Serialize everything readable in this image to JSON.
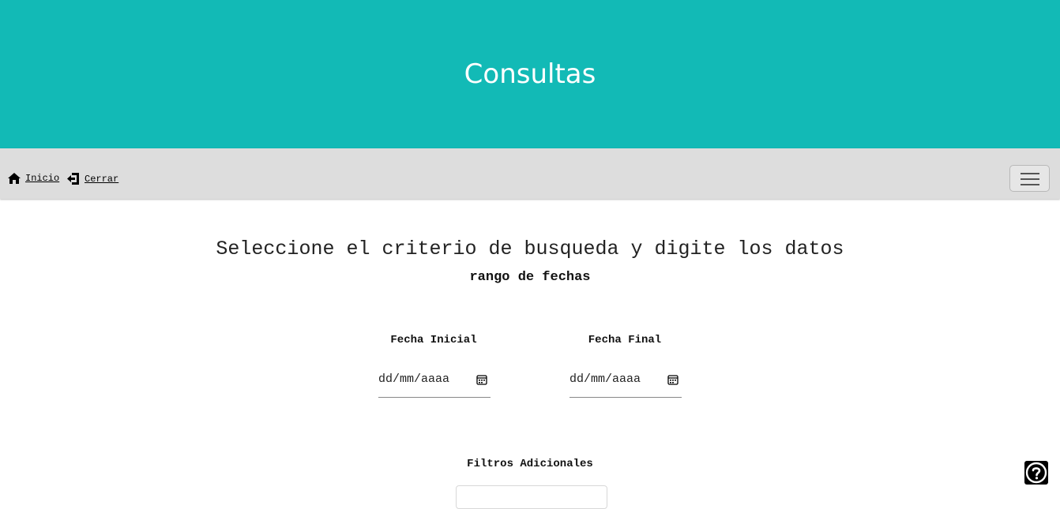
{
  "header": {
    "title": "Consultas"
  },
  "nav": {
    "home_label": "Inicio",
    "close_label": "Cerrar"
  },
  "main": {
    "heading": "Seleccione el criterio de busqueda y digite los datos",
    "subheading": "rango de fechas",
    "start_date": {
      "label": "Fecha Inicial",
      "placeholder": "dd/mm/aaaa"
    },
    "end_date": {
      "label": "Fecha Final",
      "placeholder": "dd/mm/aaaa"
    },
    "filters_label": "Filtros Adicionales"
  },
  "colors": {
    "header_bg": "#12bab6",
    "navbar_bg": "#dddddd"
  },
  "icons": [
    "home-icon",
    "sign-out-icon",
    "hamburger-icon",
    "calendar-icon",
    "help-icon"
  ]
}
